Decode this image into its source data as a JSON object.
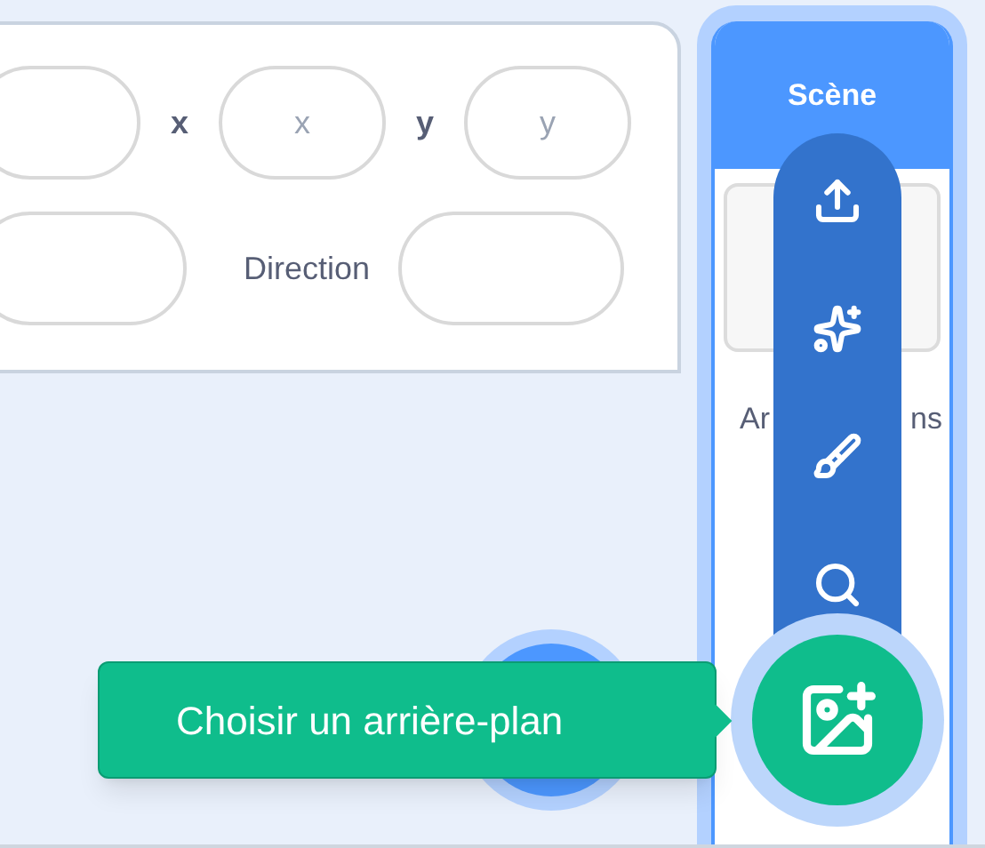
{
  "sprite_info": {
    "coordinates": [
      {
        "label": "x",
        "placeholder": "x"
      },
      {
        "label": "y",
        "placeholder": "y"
      }
    ],
    "direction_label": "Direction"
  },
  "stage": {
    "title": "Scène",
    "backdrops_label_parts": [
      "Ar",
      "ns"
    ]
  },
  "backdrop_menu": {
    "items": [
      {
        "kind": "upload"
      },
      {
        "kind": "surprise"
      },
      {
        "kind": "paint"
      },
      {
        "kind": "search"
      }
    ],
    "main_button": {
      "kind": "add-backdrop"
    }
  },
  "tooltip": "Choisir un arrière-plan"
}
